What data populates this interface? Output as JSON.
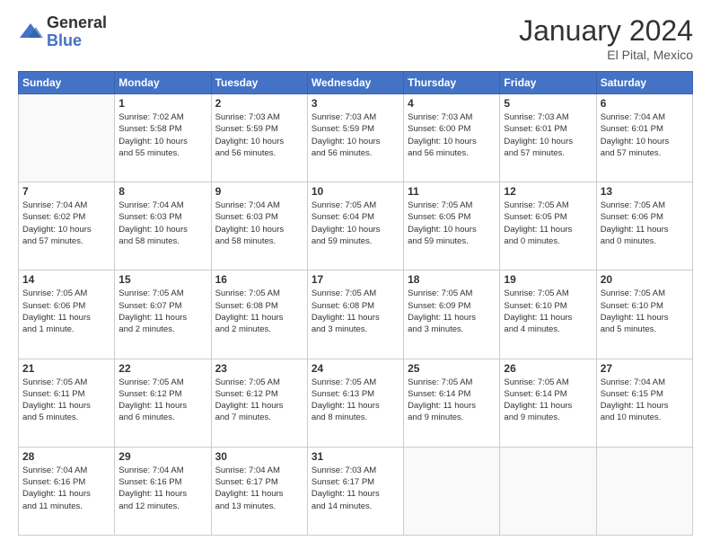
{
  "header": {
    "logo_general": "General",
    "logo_blue": "Blue",
    "month_year": "January 2024",
    "location": "El Pital, Mexico"
  },
  "weekdays": [
    "Sunday",
    "Monday",
    "Tuesday",
    "Wednesday",
    "Thursday",
    "Friday",
    "Saturday"
  ],
  "weeks": [
    [
      {
        "day": "",
        "info": ""
      },
      {
        "day": "1",
        "info": "Sunrise: 7:02 AM\nSunset: 5:58 PM\nDaylight: 10 hours\nand 55 minutes."
      },
      {
        "day": "2",
        "info": "Sunrise: 7:03 AM\nSunset: 5:59 PM\nDaylight: 10 hours\nand 56 minutes."
      },
      {
        "day": "3",
        "info": "Sunrise: 7:03 AM\nSunset: 5:59 PM\nDaylight: 10 hours\nand 56 minutes."
      },
      {
        "day": "4",
        "info": "Sunrise: 7:03 AM\nSunset: 6:00 PM\nDaylight: 10 hours\nand 56 minutes."
      },
      {
        "day": "5",
        "info": "Sunrise: 7:03 AM\nSunset: 6:01 PM\nDaylight: 10 hours\nand 57 minutes."
      },
      {
        "day": "6",
        "info": "Sunrise: 7:04 AM\nSunset: 6:01 PM\nDaylight: 10 hours\nand 57 minutes."
      }
    ],
    [
      {
        "day": "7",
        "info": "Sunrise: 7:04 AM\nSunset: 6:02 PM\nDaylight: 10 hours\nand 57 minutes."
      },
      {
        "day": "8",
        "info": "Sunrise: 7:04 AM\nSunset: 6:03 PM\nDaylight: 10 hours\nand 58 minutes."
      },
      {
        "day": "9",
        "info": "Sunrise: 7:04 AM\nSunset: 6:03 PM\nDaylight: 10 hours\nand 58 minutes."
      },
      {
        "day": "10",
        "info": "Sunrise: 7:05 AM\nSunset: 6:04 PM\nDaylight: 10 hours\nand 59 minutes."
      },
      {
        "day": "11",
        "info": "Sunrise: 7:05 AM\nSunset: 6:05 PM\nDaylight: 10 hours\nand 59 minutes."
      },
      {
        "day": "12",
        "info": "Sunrise: 7:05 AM\nSunset: 6:05 PM\nDaylight: 11 hours\nand 0 minutes."
      },
      {
        "day": "13",
        "info": "Sunrise: 7:05 AM\nSunset: 6:06 PM\nDaylight: 11 hours\nand 0 minutes."
      }
    ],
    [
      {
        "day": "14",
        "info": "Sunrise: 7:05 AM\nSunset: 6:06 PM\nDaylight: 11 hours\nand 1 minute."
      },
      {
        "day": "15",
        "info": "Sunrise: 7:05 AM\nSunset: 6:07 PM\nDaylight: 11 hours\nand 2 minutes."
      },
      {
        "day": "16",
        "info": "Sunrise: 7:05 AM\nSunset: 6:08 PM\nDaylight: 11 hours\nand 2 minutes."
      },
      {
        "day": "17",
        "info": "Sunrise: 7:05 AM\nSunset: 6:08 PM\nDaylight: 11 hours\nand 3 minutes."
      },
      {
        "day": "18",
        "info": "Sunrise: 7:05 AM\nSunset: 6:09 PM\nDaylight: 11 hours\nand 3 minutes."
      },
      {
        "day": "19",
        "info": "Sunrise: 7:05 AM\nSunset: 6:10 PM\nDaylight: 11 hours\nand 4 minutes."
      },
      {
        "day": "20",
        "info": "Sunrise: 7:05 AM\nSunset: 6:10 PM\nDaylight: 11 hours\nand 5 minutes."
      }
    ],
    [
      {
        "day": "21",
        "info": "Sunrise: 7:05 AM\nSunset: 6:11 PM\nDaylight: 11 hours\nand 5 minutes."
      },
      {
        "day": "22",
        "info": "Sunrise: 7:05 AM\nSunset: 6:12 PM\nDaylight: 11 hours\nand 6 minutes."
      },
      {
        "day": "23",
        "info": "Sunrise: 7:05 AM\nSunset: 6:12 PM\nDaylight: 11 hours\nand 7 minutes."
      },
      {
        "day": "24",
        "info": "Sunrise: 7:05 AM\nSunset: 6:13 PM\nDaylight: 11 hours\nand 8 minutes."
      },
      {
        "day": "25",
        "info": "Sunrise: 7:05 AM\nSunset: 6:14 PM\nDaylight: 11 hours\nand 9 minutes."
      },
      {
        "day": "26",
        "info": "Sunrise: 7:05 AM\nSunset: 6:14 PM\nDaylight: 11 hours\nand 9 minutes."
      },
      {
        "day": "27",
        "info": "Sunrise: 7:04 AM\nSunset: 6:15 PM\nDaylight: 11 hours\nand 10 minutes."
      }
    ],
    [
      {
        "day": "28",
        "info": "Sunrise: 7:04 AM\nSunset: 6:16 PM\nDaylight: 11 hours\nand 11 minutes."
      },
      {
        "day": "29",
        "info": "Sunrise: 7:04 AM\nSunset: 6:16 PM\nDaylight: 11 hours\nand 12 minutes."
      },
      {
        "day": "30",
        "info": "Sunrise: 7:04 AM\nSunset: 6:17 PM\nDaylight: 11 hours\nand 13 minutes."
      },
      {
        "day": "31",
        "info": "Sunrise: 7:03 AM\nSunset: 6:17 PM\nDaylight: 11 hours\nand 14 minutes."
      },
      {
        "day": "",
        "info": ""
      },
      {
        "day": "",
        "info": ""
      },
      {
        "day": "",
        "info": ""
      }
    ]
  ]
}
